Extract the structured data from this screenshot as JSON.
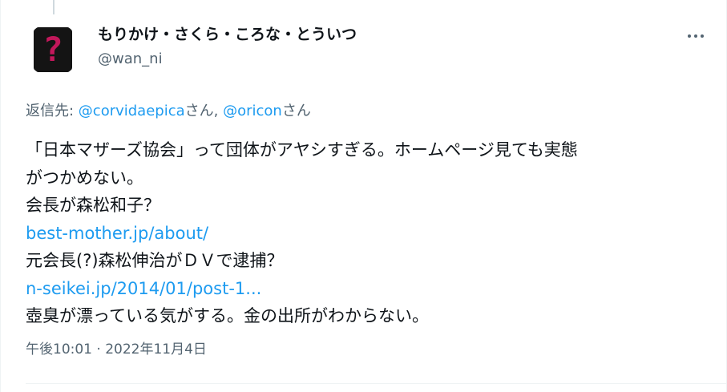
{
  "tweet": {
    "author_name": "もりかけ・さくら・ころな・とういつ",
    "author_handle": "@wan_ni",
    "avatar_glyph": "?",
    "reply_prefix": "返信先: ",
    "reply_to_1": "@corvidaepica",
    "reply_suffix_1": "さん, ",
    "reply_to_2": "@oricon",
    "reply_suffix_2": "さん",
    "lines": [
      "「日本マザーズ協会」って団体がアヤシすぎる。ホームページ見ても実態",
      "がつかめない。",
      "会長が森松和子？",
      "best-mother.jp/about/",
      "元会長(?)森松伸治がＤＶで逮捕？",
      "n-seikei.jp/2014/01/post-1...",
      "壺臭が漂っている気がする。金の出所がわからない。"
    ],
    "timestamp": "午後10:01 · 2022年11月4日"
  },
  "colors": {
    "link": "#1d9bf0",
    "secondary": "#536471",
    "avatar_glyph": "#c2185b"
  },
  "icons": {
    "more": "more-horizontal-icon"
  }
}
